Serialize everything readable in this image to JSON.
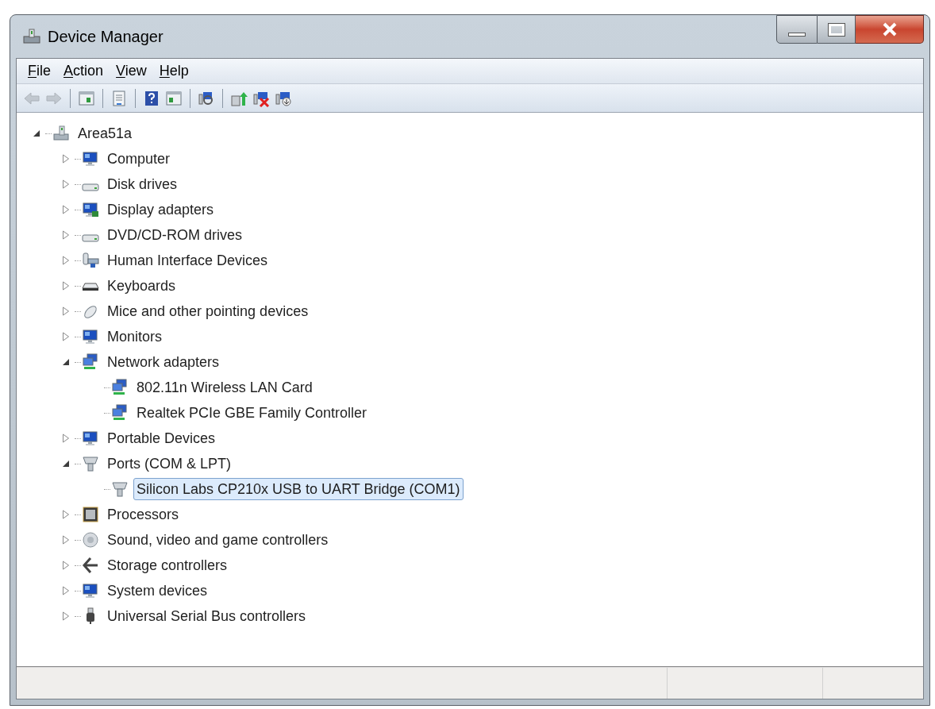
{
  "window": {
    "title": "Device Manager"
  },
  "menu": [
    {
      "label": "File"
    },
    {
      "label": "Action"
    },
    {
      "label": "View"
    },
    {
      "label": "Help"
    }
  ],
  "toolbar": [
    {
      "kind": "back",
      "disabled": true
    },
    {
      "kind": "forward",
      "disabled": true
    },
    {
      "kind": "separator"
    },
    {
      "kind": "console-tree",
      "disabled": false
    },
    {
      "kind": "separator"
    },
    {
      "kind": "properties",
      "disabled": false
    },
    {
      "kind": "separator"
    },
    {
      "kind": "help",
      "disabled": false
    },
    {
      "kind": "action-pane",
      "disabled": false
    },
    {
      "kind": "separator"
    },
    {
      "kind": "scan",
      "disabled": false
    },
    {
      "kind": "separator"
    },
    {
      "kind": "update",
      "disabled": false
    },
    {
      "kind": "uninstall",
      "disabled": false
    },
    {
      "kind": "disable",
      "disabled": false
    }
  ],
  "tree": [
    {
      "label": "Area51a",
      "kind": "host",
      "expanded": true,
      "selected": false,
      "children": [
        {
          "label": "Computer",
          "kind": "computer",
          "expanded": false,
          "selected": false
        },
        {
          "label": "Disk drives",
          "kind": "disk",
          "expanded": false,
          "selected": false
        },
        {
          "label": "Display adapters",
          "kind": "display",
          "expanded": false,
          "selected": false
        },
        {
          "label": "DVD/CD-ROM drives",
          "kind": "disk",
          "expanded": false,
          "selected": false
        },
        {
          "label": "Human Interface Devices",
          "kind": "hid",
          "expanded": false,
          "selected": false
        },
        {
          "label": "Keyboards",
          "kind": "keyboard",
          "expanded": false,
          "selected": false
        },
        {
          "label": "Mice and other pointing devices",
          "kind": "mouse",
          "expanded": false,
          "selected": false
        },
        {
          "label": "Monitors",
          "kind": "monitor",
          "expanded": false,
          "selected": false
        },
        {
          "label": "Network adapters",
          "kind": "network",
          "expanded": true,
          "selected": false,
          "children": [
            {
              "label": "802.11n Wireless LAN Card",
              "kind": "network",
              "selected": false
            },
            {
              "label": "Realtek PCIe GBE Family Controller",
              "kind": "network",
              "selected": false
            }
          ]
        },
        {
          "label": "Portable Devices",
          "kind": "computer",
          "expanded": false,
          "selected": false
        },
        {
          "label": "Ports (COM & LPT)",
          "kind": "port",
          "expanded": true,
          "selected": false,
          "children": [
            {
              "label": "Silicon Labs CP210x USB to UART Bridge (COM1)",
              "kind": "port",
              "selected": true
            }
          ]
        },
        {
          "label": "Processors",
          "kind": "chip",
          "expanded": false,
          "selected": false
        },
        {
          "label": "Sound, video and game controllers",
          "kind": "speaker",
          "expanded": false,
          "selected": false
        },
        {
          "label": "Storage controllers",
          "kind": "storage",
          "expanded": false,
          "selected": false
        },
        {
          "label": "System devices",
          "kind": "computer",
          "expanded": false,
          "selected": false
        },
        {
          "label": "Universal Serial Bus controllers",
          "kind": "usb",
          "expanded": false,
          "selected": false
        }
      ]
    }
  ]
}
